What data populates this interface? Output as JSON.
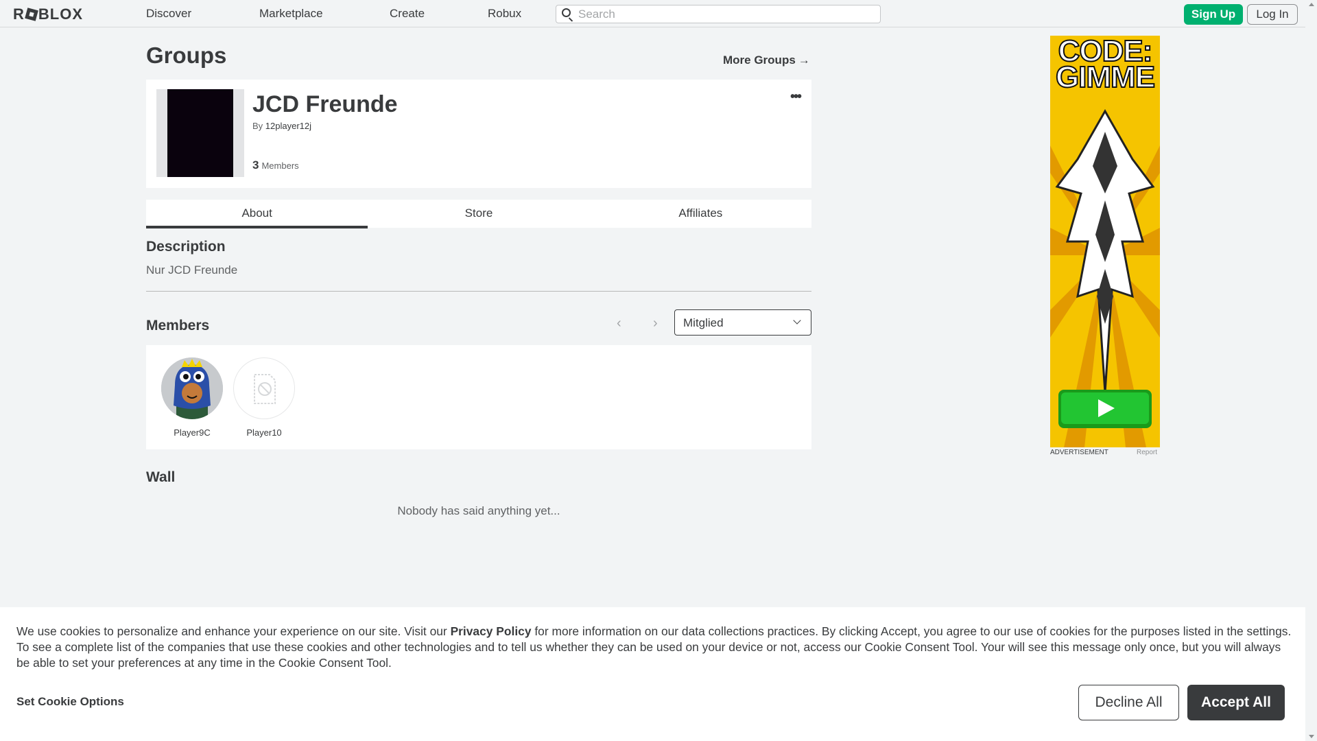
{
  "header": {
    "logo": "ROBLOX",
    "nav": [
      "Discover",
      "Marketplace",
      "Create",
      "Robux"
    ],
    "search_placeholder": "Search",
    "signup_label": "Sign Up",
    "login_label": "Log In"
  },
  "page": {
    "title": "Groups",
    "more_groups": "More Groups"
  },
  "group": {
    "name": "JCD Freunde",
    "by_label": "By",
    "owner": "12player12j",
    "member_count": "3",
    "members_label": "Members",
    "more_icon": "more-dots-icon"
  },
  "tabs": [
    {
      "label": "About",
      "active": true
    },
    {
      "label": "Store",
      "active": false
    },
    {
      "label": "Affiliates",
      "active": false
    }
  ],
  "description": {
    "title": "Description",
    "text": "Nur JCD Freunde"
  },
  "members": {
    "title": "Members",
    "role_selected": "Mitglied",
    "list": [
      {
        "name": "Player9C",
        "avatar": "avatar-blue-hood"
      },
      {
        "name": "Player10",
        "avatar": "avatar-blocked-placeholder"
      }
    ]
  },
  "wall": {
    "title": "Wall",
    "empty_text": "Nobody has said anything yet..."
  },
  "ad": {
    "headline": "CODE: GIMME",
    "label": "ADVERTISEMENT",
    "report": "Report",
    "colors": {
      "bg": "#f5c400",
      "play": "#22c532"
    }
  },
  "cookie": {
    "text_before": "We use cookies to personalize and enhance your experience on our site. Visit our ",
    "privacy_link": "Privacy Policy",
    "text_after": " for more information on our data collections practices. By clicking Accept, you agree to our use of cookies for the purposes listed in the settings. To see a complete list of the companies that use these cookies and other technologies and to tell us whether they can be used on your device or not, access our Cookie Consent Tool. Your will see this message only once, but you will always be able to set your preferences at any time in the Cookie Consent Tool.",
    "options_label": "Set Cookie Options",
    "decline_label": "Decline All",
    "accept_label": "Accept All"
  },
  "colors": {
    "accent_green": "#00b06f",
    "text_dark": "#393b3d",
    "background": "#f2f4f5"
  }
}
